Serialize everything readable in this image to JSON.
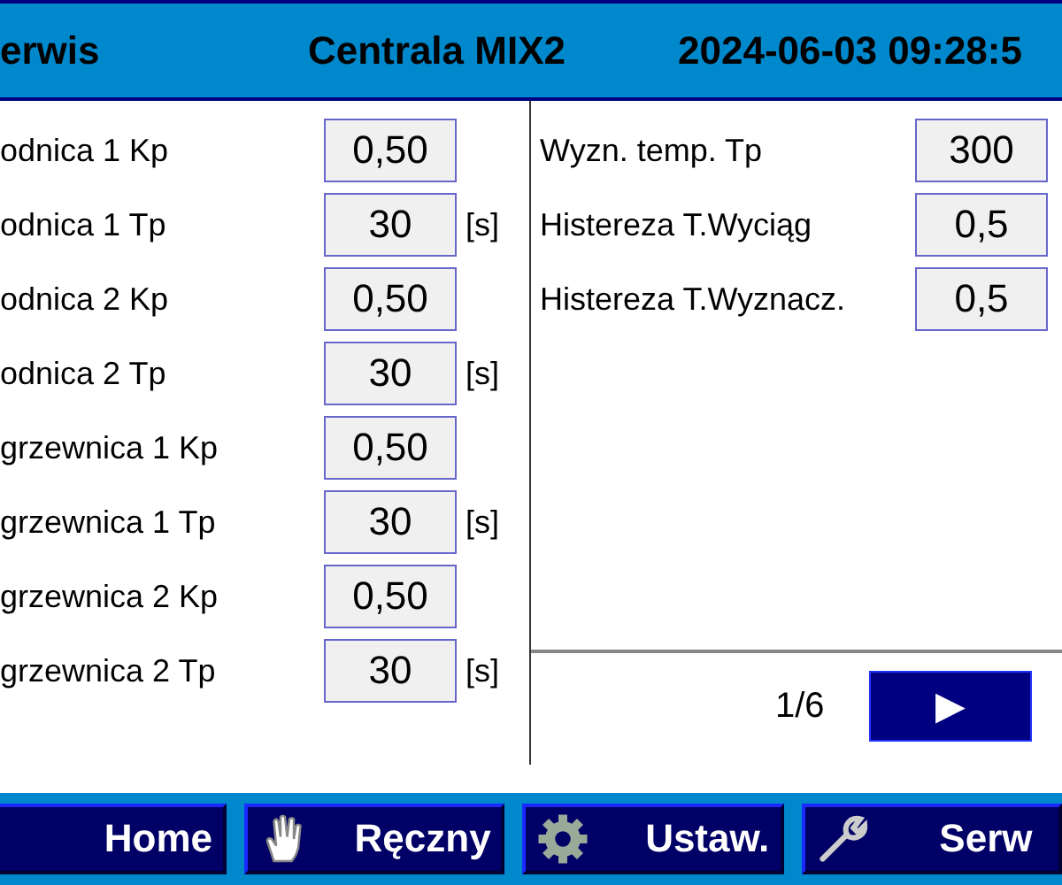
{
  "header": {
    "screen": "erwis",
    "title": "Centrala MIX2",
    "datetime": "2024-06-03 09:28:5"
  },
  "left_params": [
    {
      "label": "odnica 1 Kp",
      "value": "0,50"
    },
    {
      "label": "odnica 1 Tp",
      "value": "30",
      "unit": "[s]"
    },
    {
      "label": "odnica 2 Kp",
      "value": "0,50"
    },
    {
      "label": "odnica 2 Tp",
      "value": "30",
      "unit": "[s]"
    },
    {
      "label": "grzewnica 1 Kp",
      "value": "0,50"
    },
    {
      "label": "grzewnica 1 Tp",
      "value": "30",
      "unit": "[s]"
    },
    {
      "label": "grzewnica 2 Kp",
      "value": "0,50"
    },
    {
      "label": "grzewnica 2 Tp",
      "value": "30",
      "unit": "[s]"
    }
  ],
  "right_params": [
    {
      "label": "Wyzn. temp. Tp",
      "value": "300"
    },
    {
      "label": "Histereza T.Wyciąg",
      "value": "0,5"
    },
    {
      "label": "Histereza T.Wyznacz.",
      "value": "0,5"
    }
  ],
  "pager": {
    "page": "1/6",
    "next": "▶"
  },
  "nav": [
    {
      "label": "Home",
      "kind": "home"
    },
    {
      "label": "Ręczny",
      "kind": "manual"
    },
    {
      "label": "Ustaw.",
      "kind": "settings"
    },
    {
      "label": "Serw",
      "kind": "service"
    }
  ]
}
